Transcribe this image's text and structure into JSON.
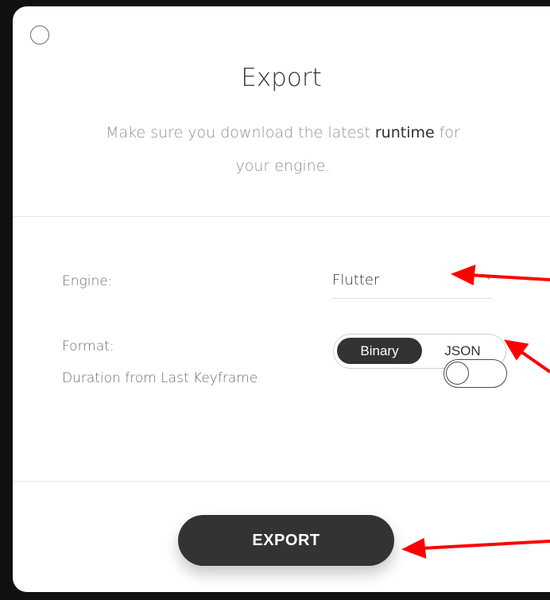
{
  "dialog": {
    "title": "Export",
    "subtitle": {
      "before": "Make sure you download the latest ",
      "link": "runtime",
      "after_line1": " for",
      "line2": "your engine."
    }
  },
  "settings": {
    "engine": {
      "label": "Engine:",
      "value": "Flutter"
    },
    "format": {
      "label": "Format:",
      "options": [
        "Binary",
        "JSON"
      ],
      "selected": "Binary"
    },
    "duration_from_last_keyframe": {
      "label": "Duration from Last Keyframe",
      "enabled": false
    }
  },
  "actions": {
    "export_label": "EXPORT"
  },
  "colors": {
    "dark": "#333333",
    "annotation": "#ff0000",
    "frame": "#111111"
  }
}
